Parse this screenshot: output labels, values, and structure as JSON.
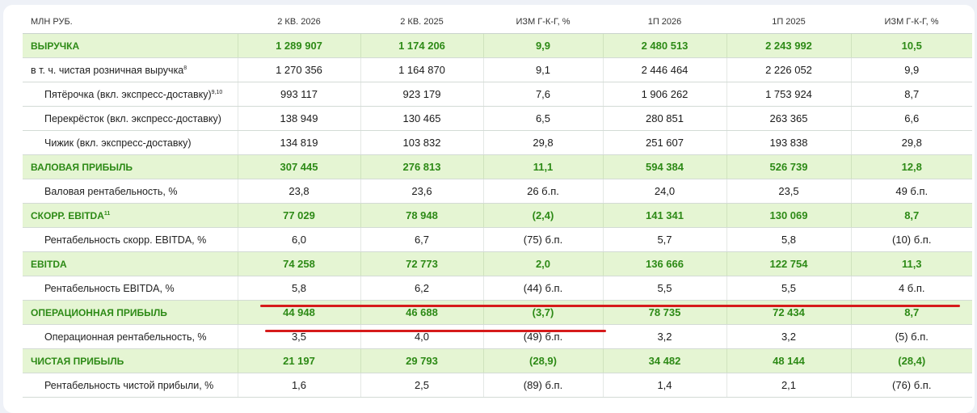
{
  "table": {
    "headers": [
      "МЛН РУБ.",
      "2 КВ. 2026",
      "2 КВ. 2025",
      "ИЗМ Г-К-Г, %",
      "1П 2026",
      "1П 2025",
      "ИЗМ Г-К-Г, %"
    ],
    "rows": [
      {
        "label": "ВЫРУЧКА",
        "sup": "",
        "values": [
          "1 289 907",
          "1 174 206",
          "9,9",
          "2 480 513",
          "2 243 992",
          "10,5"
        ]
      },
      {
        "label": "в т. ч. чистая розничная выручка",
        "sup": "8",
        "values": [
          "1 270 356",
          "1 164 870",
          "9,1",
          "2 446 464",
          "2 226 052",
          "9,9"
        ]
      },
      {
        "label": "Пятёрочка (вкл. экспресс-доставку)",
        "sup": "9,10",
        "values": [
          "993 117",
          "923 179",
          "7,6",
          "1 906 262",
          "1 753 924",
          "8,7"
        ]
      },
      {
        "label": "Перекрёсток (вкл. экспресс-доставку)",
        "sup": "",
        "values": [
          "138 949",
          "130 465",
          "6,5",
          "280 851",
          "263 365",
          "6,6"
        ]
      },
      {
        "label": "Чижик (вкл. экспресс-доставку)",
        "sup": "",
        "values": [
          "134 819",
          "103 832",
          "29,8",
          "251 607",
          "193 838",
          "29,8"
        ]
      },
      {
        "label": "ВАЛОВАЯ ПРИБЫЛЬ",
        "sup": "",
        "values": [
          "307 445",
          "276 813",
          "11,1",
          "594 384",
          "526 739",
          "12,8"
        ]
      },
      {
        "label": "Валовая рентабельность, %",
        "sup": "",
        "values": [
          "23,8",
          "23,6",
          "26 б.п.",
          "24,0",
          "23,5",
          "49 б.п."
        ]
      },
      {
        "label": "СКОРР. EBITDA",
        "sup": "11",
        "values": [
          "77 029",
          "78 948",
          "(2,4)",
          "141 341",
          "130 069",
          "8,7"
        ]
      },
      {
        "label": "Рентабельность скорр. EBITDA, %",
        "sup": "",
        "values": [
          "6,0",
          "6,7",
          "(75) б.п.",
          "5,7",
          "5,8",
          "(10) б.п."
        ]
      },
      {
        "label": "EBITDA",
        "sup": "",
        "values": [
          "74 258",
          "72 773",
          "2,0",
          "136 666",
          "122 754",
          "11,3"
        ]
      },
      {
        "label": "Рентабельность EBITDA, %",
        "sup": "",
        "values": [
          "5,8",
          "6,2",
          "(44) б.п.",
          "5,5",
          "5,5",
          "4 б.п."
        ]
      },
      {
        "label": "ОПЕРАЦИОННАЯ ПРИБЫЛЬ",
        "sup": "",
        "values": [
          "44 948",
          "46 688",
          "(3,7)",
          "78 735",
          "72 434",
          "8,7"
        ]
      },
      {
        "label": "Операционная рентабельность, %",
        "sup": "",
        "values": [
          "3,5",
          "4,0",
          "(49) б.п.",
          "3,2",
          "3,2",
          "(5) б.п."
        ]
      },
      {
        "label": "ЧИСТАЯ ПРИБЫЛЬ",
        "sup": "",
        "values": [
          "21 197",
          "29 793",
          "(28,9)",
          "34 482",
          "48 144",
          "(28,4)"
        ]
      },
      {
        "label": "Рентабельность чистой прибыли, %",
        "sup": "",
        "values": [
          "1,6",
          "2,5",
          "(89) б.п.",
          "1,4",
          "2,1",
          "(76) б.п."
        ]
      }
    ]
  },
  "colors": {
    "highlight_bg": "#e5f5d3",
    "highlight_text": "#2d8a16",
    "annotation": "#d61b1b"
  }
}
